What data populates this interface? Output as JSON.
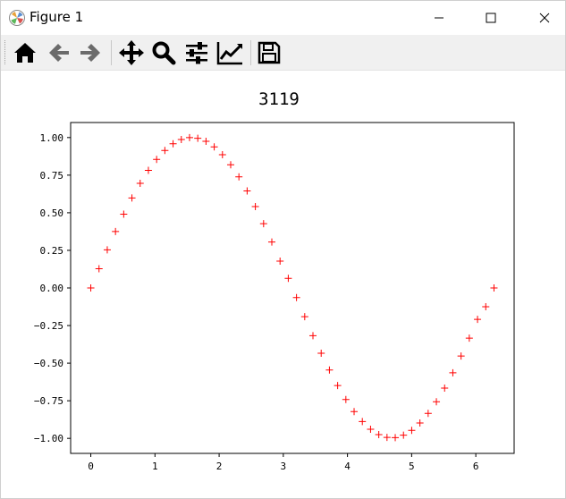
{
  "window": {
    "title": "Figure 1",
    "controls": {
      "minimize": "minimize",
      "maximize": "maximize",
      "close": "close"
    }
  },
  "toolbar": {
    "buttons": [
      {
        "name": "home",
        "icon": "home-icon"
      },
      {
        "name": "back",
        "icon": "arrow-left-icon"
      },
      {
        "name": "forward",
        "icon": "arrow-right-icon"
      },
      {
        "name": "pan",
        "icon": "move-icon"
      },
      {
        "name": "zoom",
        "icon": "magnifier-icon"
      },
      {
        "name": "configure-subplots",
        "icon": "sliders-icon"
      },
      {
        "name": "edit-axis",
        "icon": "line-chart-icon"
      },
      {
        "name": "save",
        "icon": "floppy-disk-icon"
      }
    ]
  },
  "chart_data": {
    "type": "scatter",
    "title": "3119",
    "xlabel": "",
    "ylabel": "",
    "xlim": [
      -0.3142,
      6.5973
    ],
    "ylim": [
      -1.1,
      1.1
    ],
    "xticks": [
      0,
      1,
      2,
      3,
      4,
      5,
      6
    ],
    "xtick_labels": [
      "0",
      "1",
      "2",
      "3",
      "4",
      "5",
      "6"
    ],
    "yticks": [
      -1.0,
      -0.75,
      -0.5,
      -0.25,
      0.0,
      0.25,
      0.5,
      0.75,
      1.0
    ],
    "ytick_labels": [
      "−1.00",
      "−0.75",
      "−0.50",
      "−0.25",
      "0.00",
      "0.25",
      "0.50",
      "0.75",
      "1.00"
    ],
    "grid": false,
    "marker": "+",
    "color": "#ff0000",
    "x": [
      0.0,
      0.1282,
      0.2565,
      0.3847,
      0.5129,
      0.6411,
      0.7694,
      0.8976,
      1.0258,
      1.1541,
      1.2823,
      1.4105,
      1.5387,
      1.667,
      1.7952,
      1.9234,
      2.0517,
      2.1799,
      2.3081,
      2.4363,
      2.5646,
      2.6928,
      2.821,
      2.9493,
      3.0775,
      3.2057,
      3.3339,
      3.4622,
      3.5904,
      3.7186,
      3.8468,
      3.9751,
      4.1033,
      4.2315,
      4.3598,
      4.488,
      4.6162,
      4.7444,
      4.8727,
      5.0009,
      5.1291,
      5.2574,
      5.3856,
      5.5138,
      5.642,
      5.7703,
      5.8985,
      6.0267,
      6.155,
      6.2832
    ],
    "y": [
      0.0,
      0.1279,
      0.2537,
      0.3753,
      0.4907,
      0.5981,
      0.6956,
      0.7818,
      0.8551,
      0.9144,
      0.9587,
      0.9872,
      0.9995,
      0.9954,
      0.9749,
      0.9383,
      0.8862,
      0.8193,
      0.7386,
      0.6454,
      0.541,
      0.4272,
      0.3056,
      0.1784,
      0.0641,
      -0.0641,
      -0.1912,
      -0.3171,
      -0.4339,
      -0.5455,
      -0.6491,
      -0.7418,
      -0.8221,
      -0.8885,
      -0.9397,
      -0.975,
      -0.9935,
      -0.9949,
      -0.9792,
      -0.9467,
      -0.8981,
      -0.8342,
      -0.7563,
      -0.6657,
      -0.5638,
      -0.4525,
      -0.3336,
      -0.2091,
      -0.1249,
      0.0
    ]
  }
}
